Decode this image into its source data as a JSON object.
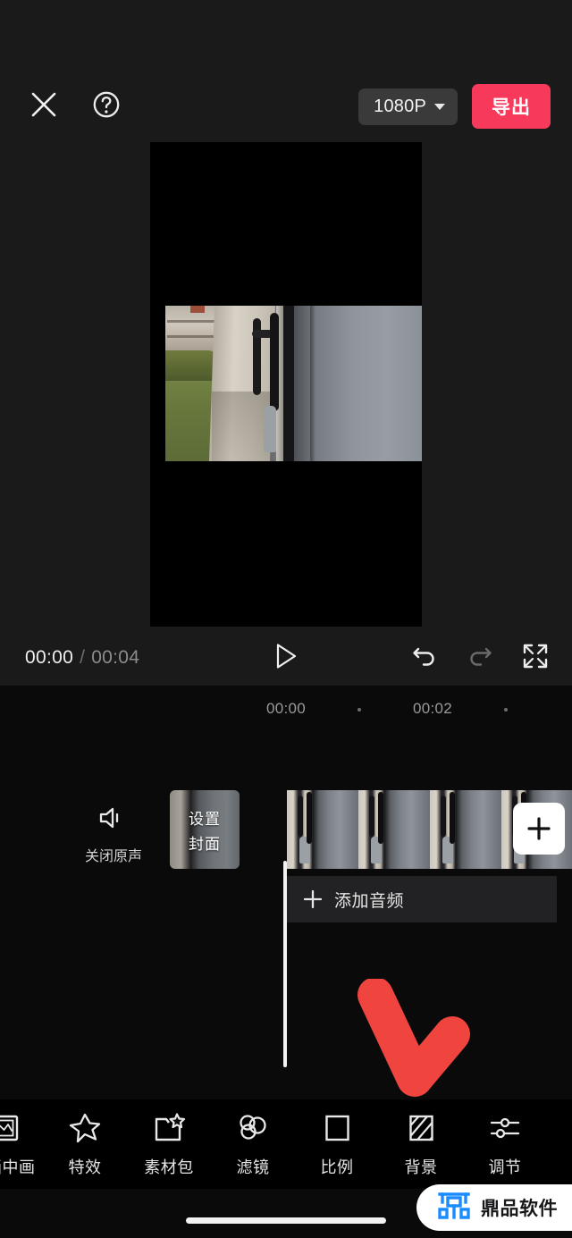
{
  "header": {
    "close_icon": "close-icon",
    "help_icon": "help-circle-icon",
    "resolution": "1080P",
    "resolution_caret": "chevron-down-icon",
    "export_label": "导出",
    "export_color": "#f7395c"
  },
  "preview": {
    "background": "#000000",
    "scene_description": "doorway view"
  },
  "player": {
    "current_time": "00:00",
    "separator": "/",
    "total_time": "00:04",
    "play_icon": "play-icon",
    "undo_icon": "undo-icon",
    "redo_icon": "redo-icon",
    "fullscreen_icon": "fullscreen-icon"
  },
  "timeline": {
    "ruler": {
      "labels": [
        "00:00",
        "00:02"
      ],
      "tick_marks": [
        "dot",
        "dot"
      ]
    },
    "audio_toggle": {
      "icon": "speaker-mute-icon",
      "label": "关闭原声"
    },
    "cover_button": {
      "line1": "设置",
      "line2": "封面"
    },
    "add_clip_label": "+",
    "add_audio_label": "添加音频",
    "add_audio_icon": "plus-icon"
  },
  "annotation": {
    "arrow_color": "#f0453f",
    "arrow_name": "red-down-arrow"
  },
  "toolbar": {
    "items": [
      {
        "label": "画中画",
        "icon": "picture-in-picture-icon"
      },
      {
        "label": "特效",
        "icon": "star-effects-icon"
      },
      {
        "label": "素材包",
        "icon": "material-pack-icon"
      },
      {
        "label": "滤镜",
        "icon": "filter-circles-icon"
      },
      {
        "label": "比例",
        "icon": "aspect-ratio-icon"
      },
      {
        "label": "背景",
        "icon": "background-stripes-icon"
      },
      {
        "label": "调节",
        "icon": "adjust-sliders-icon"
      }
    ]
  },
  "watermark": {
    "logo_icon": "dingpin-logo-icon",
    "text": "鼎品软件",
    "logo_color": "#1a8cff"
  }
}
